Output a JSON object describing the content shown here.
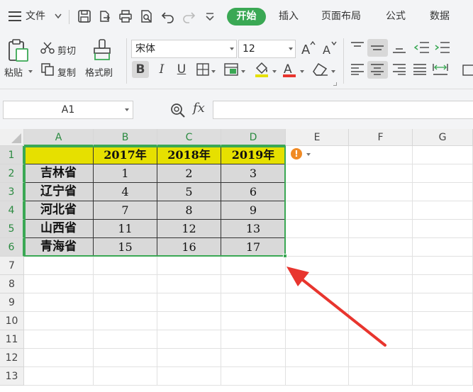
{
  "menu": {
    "file": "文件",
    "tabs": [
      "开始",
      "插入",
      "页面布局",
      "公式",
      "数据"
    ]
  },
  "ribbon": {
    "paste": "粘贴",
    "cut": "剪切",
    "copy": "复制",
    "format_painter": "格式刷",
    "font_name": "宋体",
    "font_size": "12",
    "bold": "B",
    "italic": "I",
    "underline": "U",
    "font_color_glyph": "A"
  },
  "formula_bar": {
    "cell_ref": "A1",
    "fx": "fx",
    "content": ""
  },
  "sheet": {
    "columns": [
      "A",
      "B",
      "C",
      "D",
      "E",
      "F",
      "G"
    ],
    "rows": [
      "1",
      "2",
      "3",
      "4",
      "5",
      "6",
      "7",
      "8",
      "9",
      "10",
      "11",
      "12",
      "13"
    ],
    "header_row": [
      "",
      "2017年",
      "2018年",
      "2019年"
    ],
    "data": [
      [
        "吉林省",
        "1",
        "2",
        "3"
      ],
      [
        "辽宁省",
        "4",
        "5",
        "6"
      ],
      [
        "河北省",
        "7",
        "8",
        "9"
      ],
      [
        "山西省",
        "11",
        "12",
        "13"
      ],
      [
        "青海省",
        "15",
        "16",
        "17"
      ]
    ],
    "smart_tag": "!"
  },
  "colors": {
    "accent": "#3aa854",
    "header_fill": "#e6e000",
    "data_fill": "#d9d9d9",
    "arrow": "#e8352e"
  }
}
